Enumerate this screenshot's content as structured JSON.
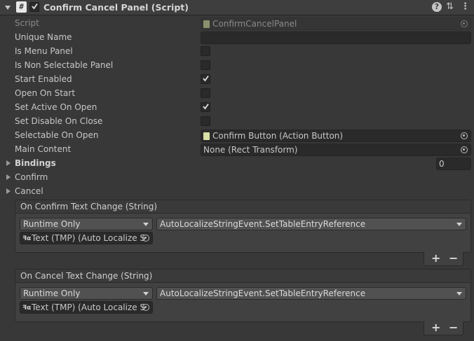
{
  "header": {
    "title": "Confirm Cancel Panel (Script)",
    "icons": [
      "foldout-arrow",
      "script-icon",
      "enabled-checkbox",
      "help-icon",
      "preset-icon",
      "more-icon"
    ],
    "help_glyph": "?",
    "preset_glyph": "⇅",
    "more_glyph": "⋮",
    "script_glyph": "#"
  },
  "properties": {
    "script": {
      "label": "Script",
      "value": "ConfirmCancelPanel"
    },
    "unique_name": {
      "label": "Unique Name",
      "value": ""
    },
    "is_menu_panel": {
      "label": "Is Menu Panel",
      "checked": false
    },
    "is_non_selectable_panel": {
      "label": "Is Non Selectable Panel",
      "checked": false
    },
    "start_enabled": {
      "label": "Start Enabled",
      "checked": true
    },
    "open_on_start": {
      "label": "Open On Start",
      "checked": false
    },
    "set_active_on_open": {
      "label": "Set Active On Open",
      "checked": true
    },
    "set_disable_on_close": {
      "label": "Set Disable On Close",
      "checked": false
    },
    "selectable_on_open": {
      "label": "Selectable On Open",
      "value": "Confirm Button (Action Button)"
    },
    "main_content": {
      "label": "Main Content",
      "value": "None (Rect Transform)"
    },
    "bindings": {
      "label": "Bindings",
      "count": "0"
    },
    "confirm": {
      "label": "Confirm"
    },
    "cancel": {
      "label": "Cancel"
    }
  },
  "events": [
    {
      "title": "On Confirm Text Change (String)",
      "runtime": "Runtime Only",
      "function": "AutoLocalizeStringEvent.SetTableEntryReference",
      "target": "Text (TMP) (Auto Localize S"
    },
    {
      "title": "On Cancel Text Change (String)",
      "runtime": "Runtime Only",
      "function": "AutoLocalizeStringEvent.SetTableEntryReference",
      "target": "Text (TMP) (Auto Localize S"
    }
  ],
  "buttons": {
    "plus": "+",
    "minus": "−"
  },
  "colors": {
    "background": "#383838",
    "field": "#2a2a2a",
    "text": "#c8c8c8",
    "script_icon": "#d9dfa6"
  }
}
